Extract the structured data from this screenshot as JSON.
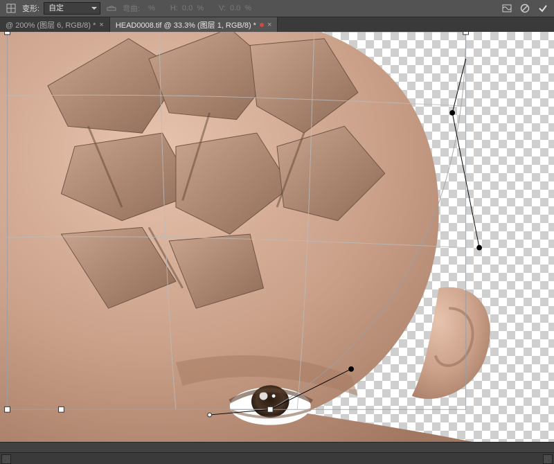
{
  "options": {
    "warp_label": "变形:",
    "warp_preset": "自定",
    "bend_label": "弯曲:",
    "bend_value": "",
    "pct": "%",
    "h_label": "H:",
    "h_value": "0.0",
    "v_label": "V:",
    "v_value": "0.0"
  },
  "icons": {
    "grid": "grid-icon",
    "orientation": "orientation-icon",
    "warp_mode": "warp-mode-icon",
    "cancel": "cancel-icon",
    "commit": "commit-icon"
  },
  "tabs": [
    {
      "label": "@ 200% (图层 6, RGB/8) *",
      "active": false
    },
    {
      "label": "HEAD0008.tif @ 33.3% (图层 1, RGB/8) *",
      "active": true
    }
  ],
  "document": {
    "title": "HEAD0008.tif",
    "zoom": "33.3%",
    "layer": "图层 1",
    "mode": "RGB/8"
  }
}
